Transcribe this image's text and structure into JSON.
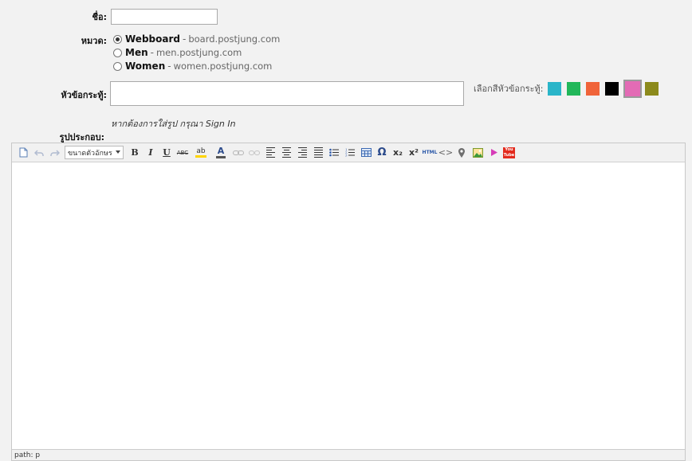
{
  "form": {
    "name_label": "ชื่อ:",
    "category_label": "หมวด:",
    "title_label": "หัวข้อกระทู้:",
    "hint": "หากต้องการใส่รูป กรุณา Sign In",
    "image_label": "รูปประกอบ:",
    "name_value": "",
    "title_value": ""
  },
  "categories": [
    {
      "name": "Webboard",
      "domain": "board.postjung.com",
      "selected": true
    },
    {
      "name": "Men",
      "domain": "men.postjung.com",
      "selected": false
    },
    {
      "name": "Women",
      "domain": "women.postjung.com",
      "selected": false
    }
  ],
  "color_picker": {
    "label": "เลือกสีหัวข้อกระทู้:",
    "swatches": [
      "#2ab5c9",
      "#22b75a",
      "#f0643a",
      "#000000",
      "#e36bb5",
      "#8c8a1c"
    ],
    "selected_index": 4
  },
  "editor": {
    "font_size_select": "ขนาดตัวอักษร",
    "status_path": "path: p",
    "icons": [
      "new-document-icon",
      "undo-icon",
      "redo-icon",
      "bold-icon",
      "italic-icon",
      "underline-icon",
      "strikethrough-icon",
      "highlight-color-icon",
      "font-color-icon",
      "link-icon",
      "unlink-icon",
      "align-left-icon",
      "align-center-icon",
      "align-right-icon",
      "align-justify-icon",
      "bullet-list-icon",
      "numbered-list-icon",
      "table-icon",
      "special-char-icon",
      "subscript-icon",
      "superscript-icon",
      "html-icon",
      "code-icon",
      "map-pin-icon",
      "insert-image-icon",
      "media-icon",
      "youtube-icon"
    ],
    "glyphs": {
      "omega": "Ω",
      "abc": "ABC",
      "html": "HTML",
      "subscript": "x₂",
      "superscript": "x²",
      "font_color": "A",
      "bold": "B",
      "italic": "I",
      "underline": "U",
      "highlight": "ab",
      "youtube": "You Tube",
      "code": "<>"
    }
  }
}
